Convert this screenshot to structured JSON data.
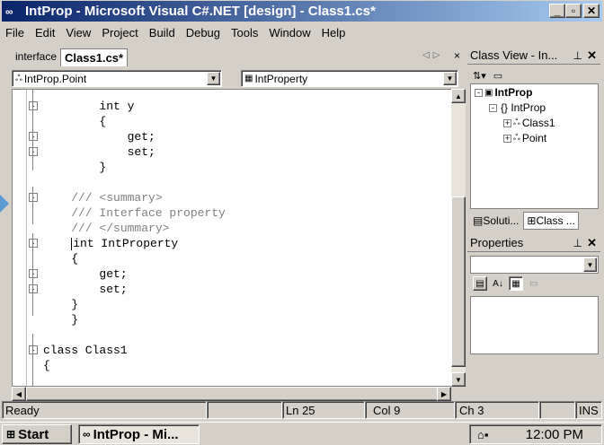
{
  "window": {
    "title": "IntProp - Microsoft Visual C#.NET [design] - Class1.cs*"
  },
  "menu": [
    "File",
    "Edit",
    "View",
    "Project",
    "Build",
    "Debug",
    "Tools",
    "Window",
    "Help"
  ],
  "doc_tabs": [
    {
      "label": "interface",
      "active": false
    },
    {
      "label": "Class1.cs*",
      "active": true
    }
  ],
  "tab_nav": {
    "left": "◁",
    "right": "▷",
    "close": "×"
  },
  "type_combo": "IntProp.Point",
  "member_combo": "IntProperty",
  "code_lines": [
    {
      "text": "        int y",
      "fold": "-",
      "class": "c-kw"
    },
    {
      "text": "        {",
      "fold": "",
      "class": "c-kw"
    },
    {
      "text": "            get;",
      "fold": "-",
      "class": "c-kw"
    },
    {
      "text": "            set;",
      "fold": "-",
      "class": "c-kw"
    },
    {
      "text": "        }",
      "fold": "",
      "class": "c-kw"
    },
    {
      "text": "",
      "fold": "",
      "class": "c-kw"
    },
    {
      "text": "    /// <summary>",
      "fold": "-",
      "class": "c-cm"
    },
    {
      "text": "    /// Interface property",
      "fold": "",
      "class": "c-cm"
    },
    {
      "text": "    /// </summary>",
      "fold": "",
      "class": "c-cm"
    },
    {
      "text": "    int IntProperty",
      "fold": "-",
      "class": "c-kw",
      "caret": true
    },
    {
      "text": "    {",
      "fold": "",
      "class": "c-kw"
    },
    {
      "text": "        get;",
      "fold": "-",
      "class": "c-kw"
    },
    {
      "text": "        set;",
      "fold": "-",
      "class": "c-kw"
    },
    {
      "text": "    }",
      "fold": "",
      "class": "c-kw"
    },
    {
      "text": "    }",
      "fold": "",
      "class": "c-kw"
    },
    {
      "text": "",
      "fold": "",
      "class": "c-kw"
    },
    {
      "text": "class Class1",
      "fold": "-",
      "class": "c-kw"
    },
    {
      "text": "{",
      "fold": "",
      "class": "c-kw"
    }
  ],
  "class_view": {
    "title": "Class View - In...",
    "items": [
      {
        "label": "IntProp",
        "bold": true,
        "exp": "-"
      },
      {
        "label": "{} IntProp",
        "bold": false,
        "exp": "-"
      },
      {
        "label": "Class1",
        "bold": false,
        "exp": "+"
      },
      {
        "label": "Point",
        "bold": false,
        "exp": "+"
      }
    ]
  },
  "panel_tabs": [
    "Soluti...",
    "Class ..."
  ],
  "properties": {
    "title": "Properties"
  },
  "status": {
    "ready": "Ready",
    "ln": "Ln 25",
    "col": "Col 9",
    "ch": "Ch 3",
    "ins": "INS"
  },
  "taskbar": {
    "start": "Start",
    "item": "IntProp - Mi...",
    "clock": "12:00 PM"
  }
}
